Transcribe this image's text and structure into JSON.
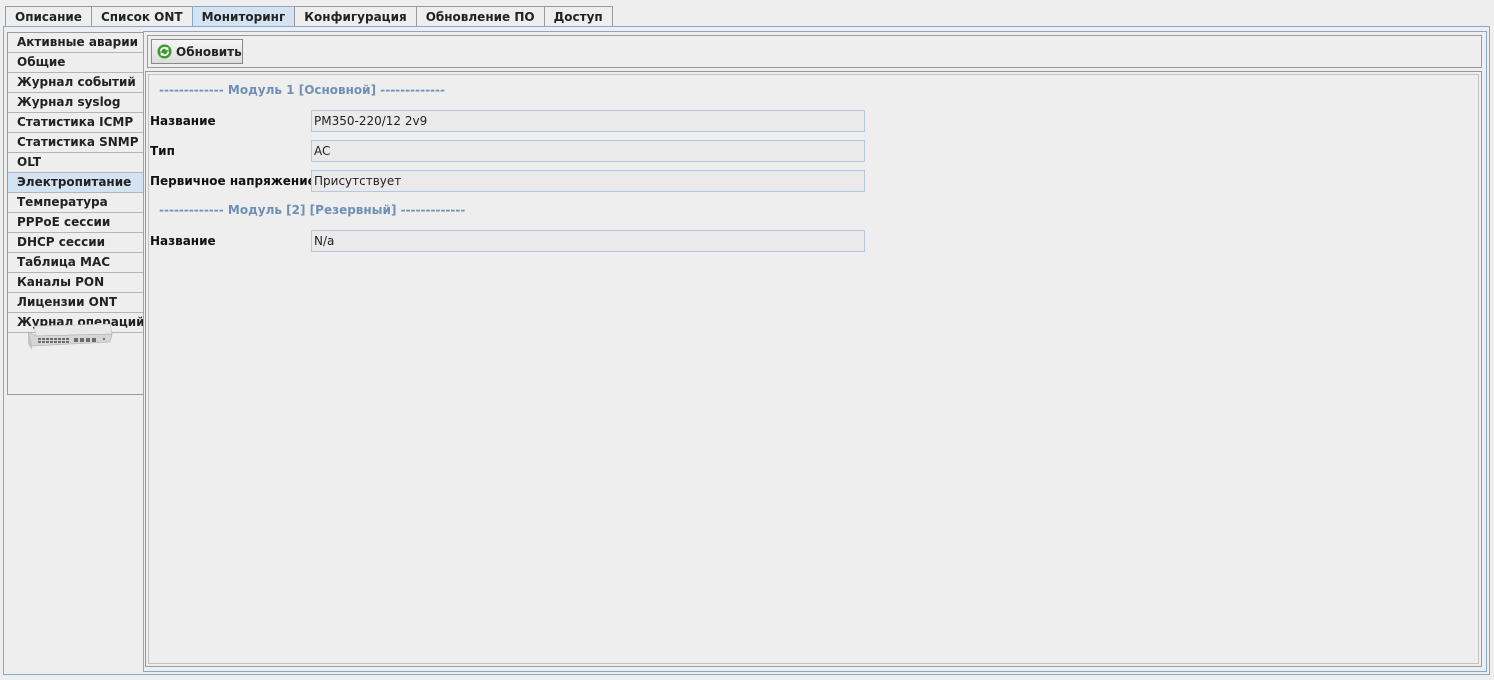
{
  "top_tabs": [
    "Описание",
    "Список ONT",
    "Мониторинг",
    "Конфигурация",
    "Обновление ПО",
    "Доступ"
  ],
  "active_top_tab": "Мониторинг",
  "sidebar": {
    "items": [
      "Активные аварии",
      "Общие",
      "Журнал событий",
      "Журнал syslog",
      "Статистика ICMP",
      "Статистика SNMP",
      "OLT",
      "Электропитание",
      "Температура",
      "PPPoE сессии",
      "DHCP сессии",
      "Таблица MAC",
      "Каналы PON",
      "Лицензии ONT",
      "Журнал операций"
    ],
    "active": "Электропитание"
  },
  "toolbar": {
    "refresh_label": "Обновить"
  },
  "module1": {
    "title": "------------- Модуль 1 [Основной] -------------",
    "name_label": "Название",
    "name_value": "PM350-220/12 2v9",
    "type_label": "Тип",
    "type_value": "AC",
    "voltage_label": "Первичное напряжение",
    "voltage_value": "Присутствует"
  },
  "module2": {
    "title": "------------- Модуль [2] [Резервный] -------------",
    "name_label": "Название",
    "name_value": "N/a"
  },
  "colors": {
    "accent": "#d4e3f2",
    "section_title": "#6f8fb5",
    "frame": "#8aa7c7"
  }
}
